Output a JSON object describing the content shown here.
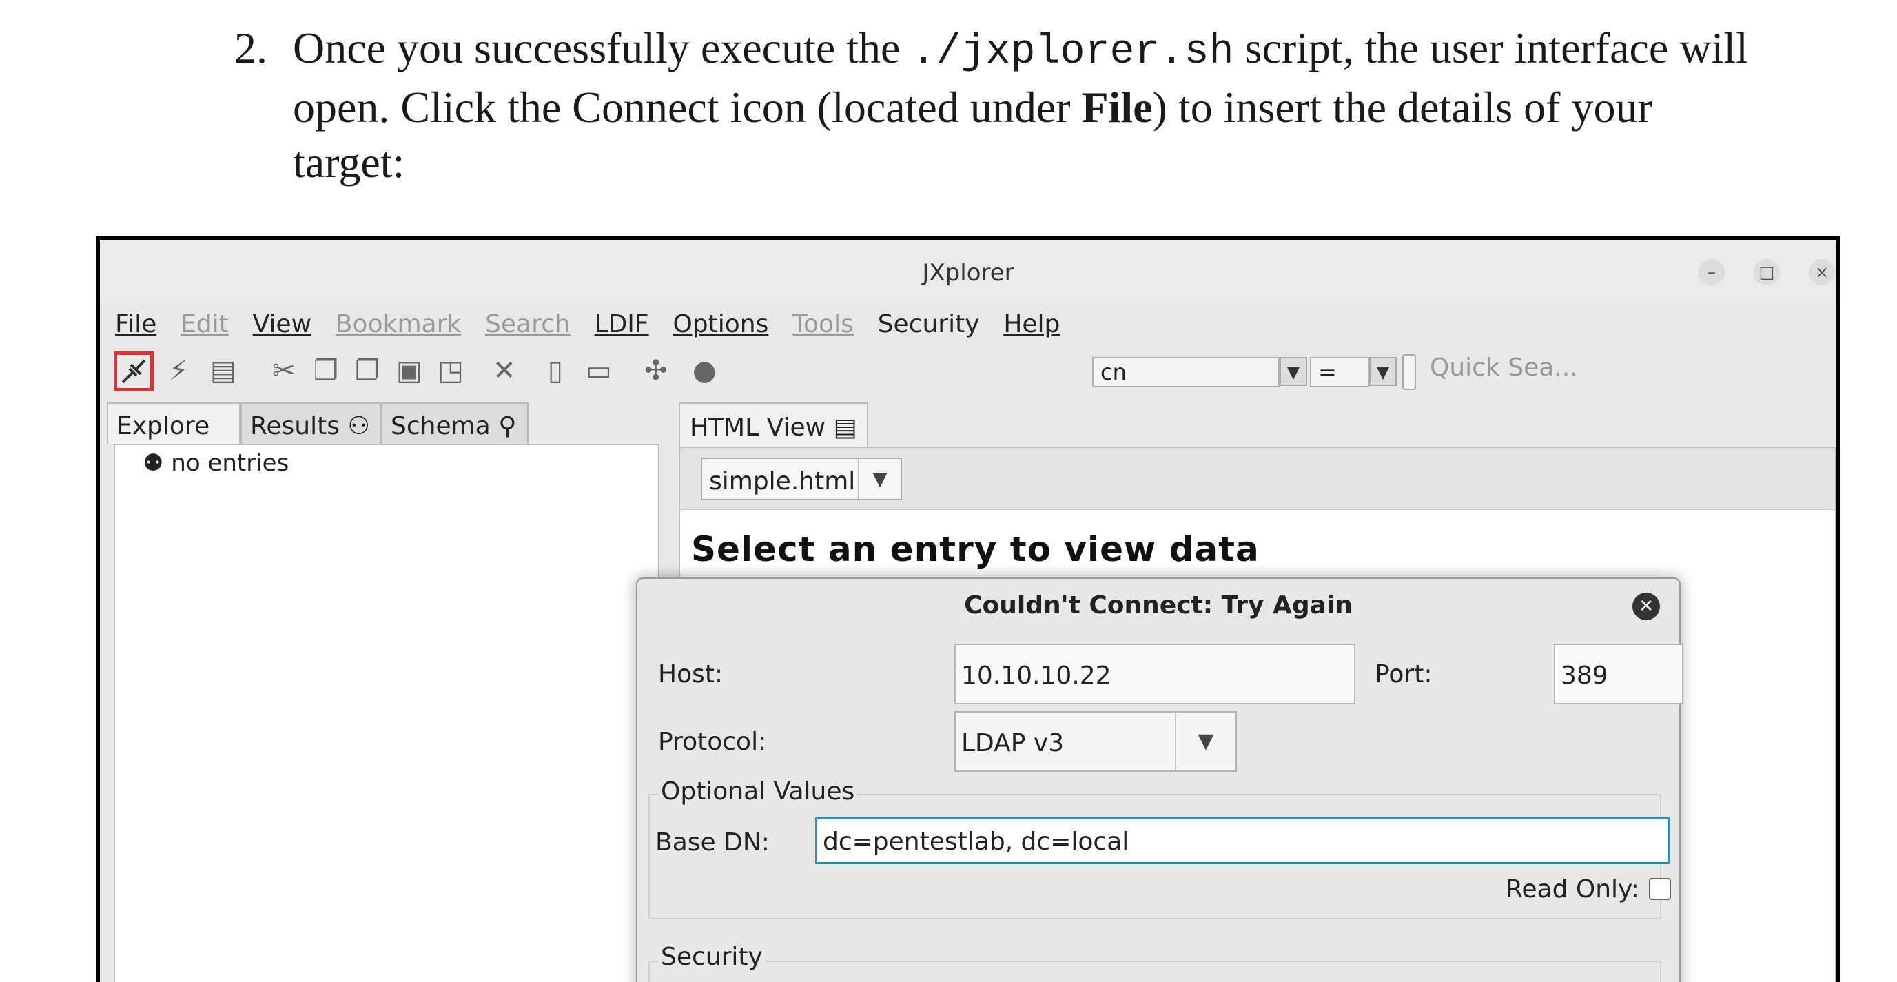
{
  "step": {
    "number": "2.",
    "line1_pre": "Once you successfully execute the ",
    "line1_code": "./jxplorer.sh",
    "line1_post": " script, the user interface will",
    "line2_pre": "open. Click the Connect icon (located under ",
    "line2_bold": "File",
    "line2_post": ") to insert the details of your",
    "line3": "target:"
  },
  "window": {
    "title": "JXplorer",
    "controls": [
      "–",
      "□",
      "×"
    ]
  },
  "menu": {
    "file": "File",
    "edit": "Edit",
    "view": "View",
    "bookmark": "Bookmark",
    "search": "Search",
    "ldif": "LDIF",
    "options": "Options",
    "tools": "Tools",
    "security": "Security",
    "help": "Help"
  },
  "toolbar": {
    "attribute_value": "cn",
    "operator_value": "=",
    "quick_search_placeholder": "Quick Sea..."
  },
  "left_tabs": {
    "explore": "Explore",
    "results": "Results",
    "schema": "Schema"
  },
  "tree": {
    "empty_label": "no entries"
  },
  "right": {
    "tab": "HTML View",
    "template": "simple.html",
    "heading": "Select an entry to view data"
  },
  "dialog": {
    "title": "Couldn't Connect: Try Again",
    "host_label": "Host:",
    "host_value": "10.10.10.22",
    "port_label": "Port:",
    "port_value": "389",
    "protocol_label": "Protocol:",
    "protocol_value": "LDAP v3",
    "optional_title": "Optional Values",
    "basedn_label": "Base DN:",
    "basedn_value": "dc=pentestlab, dc=local",
    "readonly_label": "Read Only:",
    "security_title": "Security"
  }
}
